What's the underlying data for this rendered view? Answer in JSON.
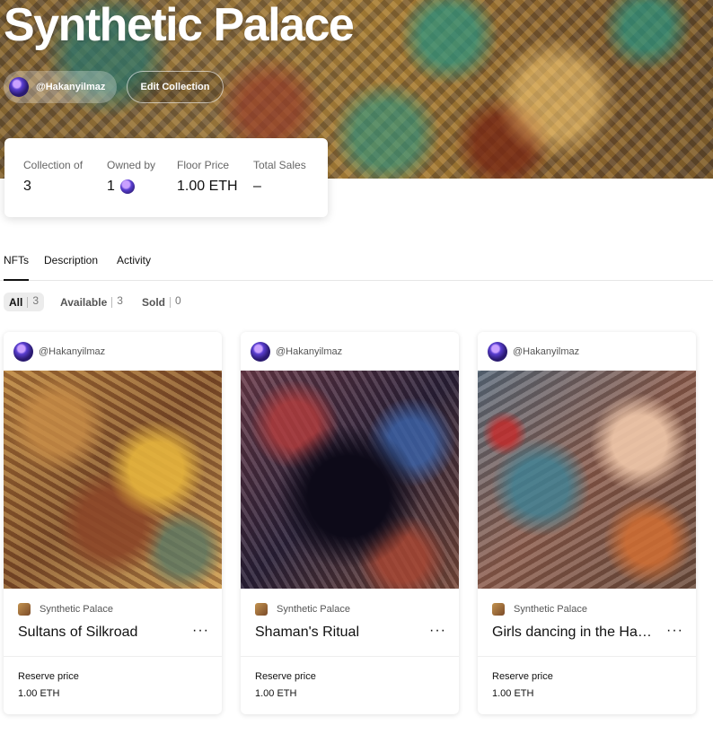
{
  "collection": {
    "title": "Synthetic Palace",
    "owner_handle": "@Hakanyilmaz",
    "edit_label": "Edit Collection"
  },
  "stats": {
    "collection_of_label": "Collection of",
    "collection_of_value": "3",
    "owned_by_label": "Owned by",
    "owned_by_value": "1",
    "floor_price_label": "Floor Price",
    "floor_price_value": "1.00 ETH",
    "total_sales_label": "Total Sales",
    "total_sales_value": "–"
  },
  "tabs": [
    {
      "label": "NFTs",
      "active": true
    },
    {
      "label": "Description",
      "active": false
    },
    {
      "label": "Activity",
      "active": false
    }
  ],
  "filters": [
    {
      "label": "All",
      "count": "3",
      "active": true
    },
    {
      "label": "Available",
      "count": "3",
      "active": false
    },
    {
      "label": "Sold",
      "count": "0",
      "active": false
    }
  ],
  "cards": [
    {
      "creator": "@Hakanyilmaz",
      "collection": "Synthetic Palace",
      "title": "Sultans of Silkroad",
      "more": "···",
      "price_label": "Reserve price",
      "price": "1.00 ETH"
    },
    {
      "creator": "@Hakanyilmaz",
      "collection": "Synthetic Palace",
      "title": "Shaman's Ritual",
      "more": "···",
      "price_label": "Reserve price",
      "price": "1.00 ETH"
    },
    {
      "creator": "@Hakanyilmaz",
      "collection": "Synthetic Palace",
      "title": "Girls dancing in the Ha…",
      "more": "···",
      "price_label": "Reserve price",
      "price": "1.00 ETH"
    }
  ]
}
